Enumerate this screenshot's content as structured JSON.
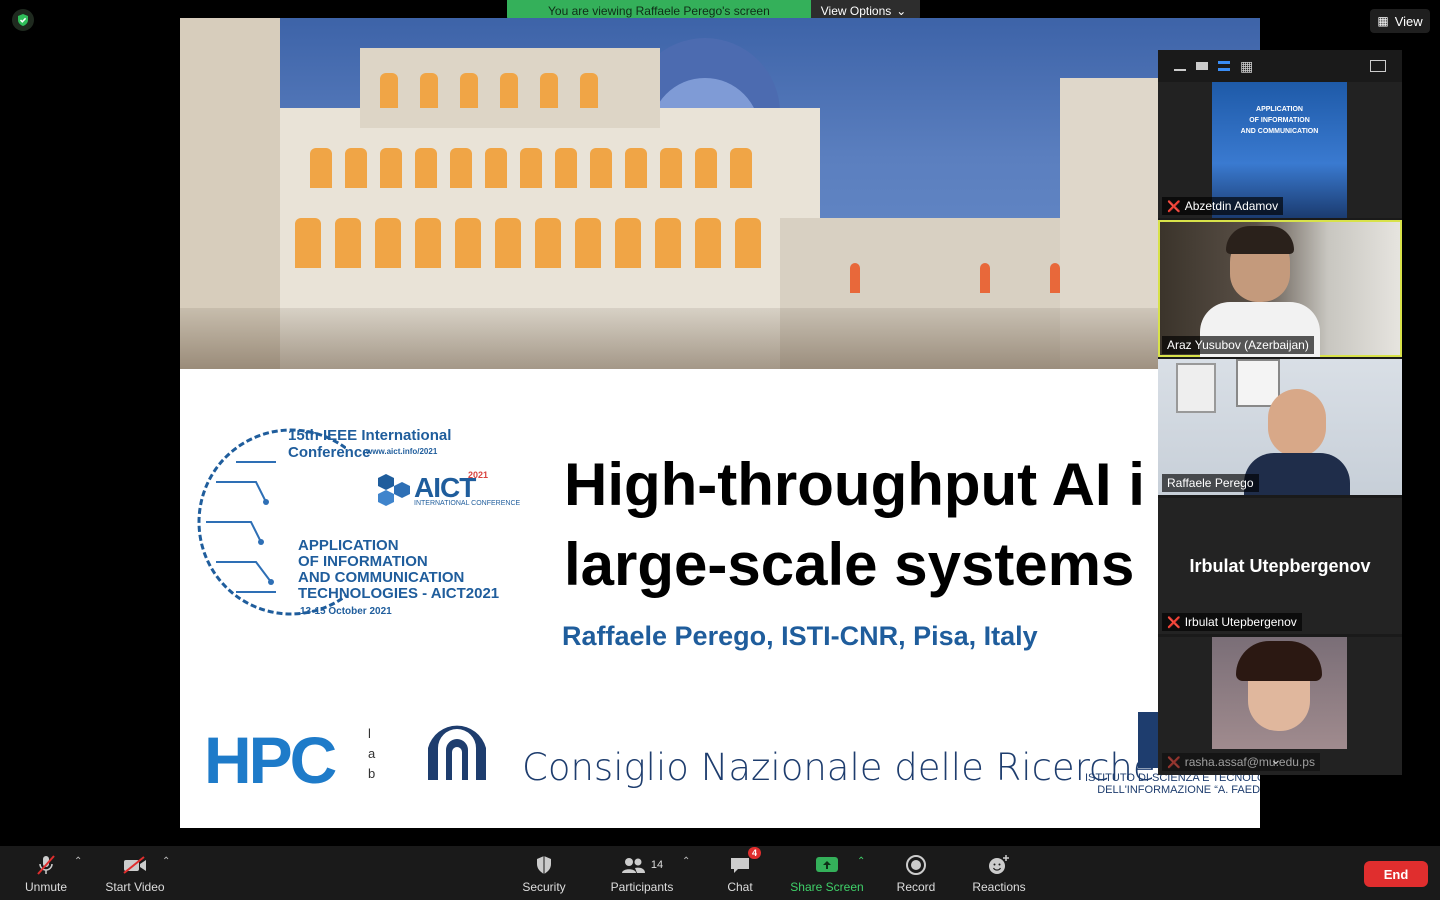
{
  "banner": {
    "text": "You are viewing Raffaele Perego's screen",
    "options_label": "View Options"
  },
  "view_button": {
    "label": "View"
  },
  "slide": {
    "title_line1": "High-throughput AI i",
    "title_line2": "large-scale systems",
    "author": "Raffaele Perego, ISTI-CNR, Pisa, Italy",
    "conference_logo": {
      "edition": "15th IEEE International Conference",
      "url": "www.aict.info/2021",
      "brand": "AICT",
      "year": "2021",
      "brand_sub": "INTERNATIONAL CONFERENCE",
      "lines": [
        "APPLICATION",
        "OF INFORMATION",
        "AND COMMUNICATION",
        "TECHNOLOGIES - AICT2021"
      ],
      "dates": "13-15 October 2021"
    },
    "hpc_logo": {
      "text": "HPC",
      "lab": "lab"
    },
    "cnr_text": "Consiglio Nazionale delle Ricerche",
    "isti_line1": "ISTITUTO DI SCIENZA E TECNOLOGIE",
    "isti_line2": "DELL'INFORMAZIONE “A. FAEDO”"
  },
  "participants": [
    {
      "name": "Abzetdin Adamov",
      "muted": true
    },
    {
      "name": "Araz Yusubov (Azerbaijan)",
      "muted": false
    },
    {
      "name": "Raffaele Perego",
      "muted": false
    },
    {
      "name": "Irbulat Utepbergenov",
      "muted": true,
      "display_name": "Irbulat Utepbergenov"
    },
    {
      "name": "rasha.assaf@mu.edu.ps",
      "muted": true
    }
  ],
  "toolbar": {
    "unmute": "Unmute",
    "start_video": "Start Video",
    "security": "Security",
    "participants": "Participants",
    "participants_count": "14",
    "chat": "Chat",
    "chat_badge": "4",
    "share_screen": "Share Screen",
    "record": "Record",
    "reactions": "Reactions",
    "end": "End"
  },
  "colors": {
    "share_green": "#34b05a",
    "end_red": "#e02e2e",
    "title_blue": "#1f5d9c"
  }
}
